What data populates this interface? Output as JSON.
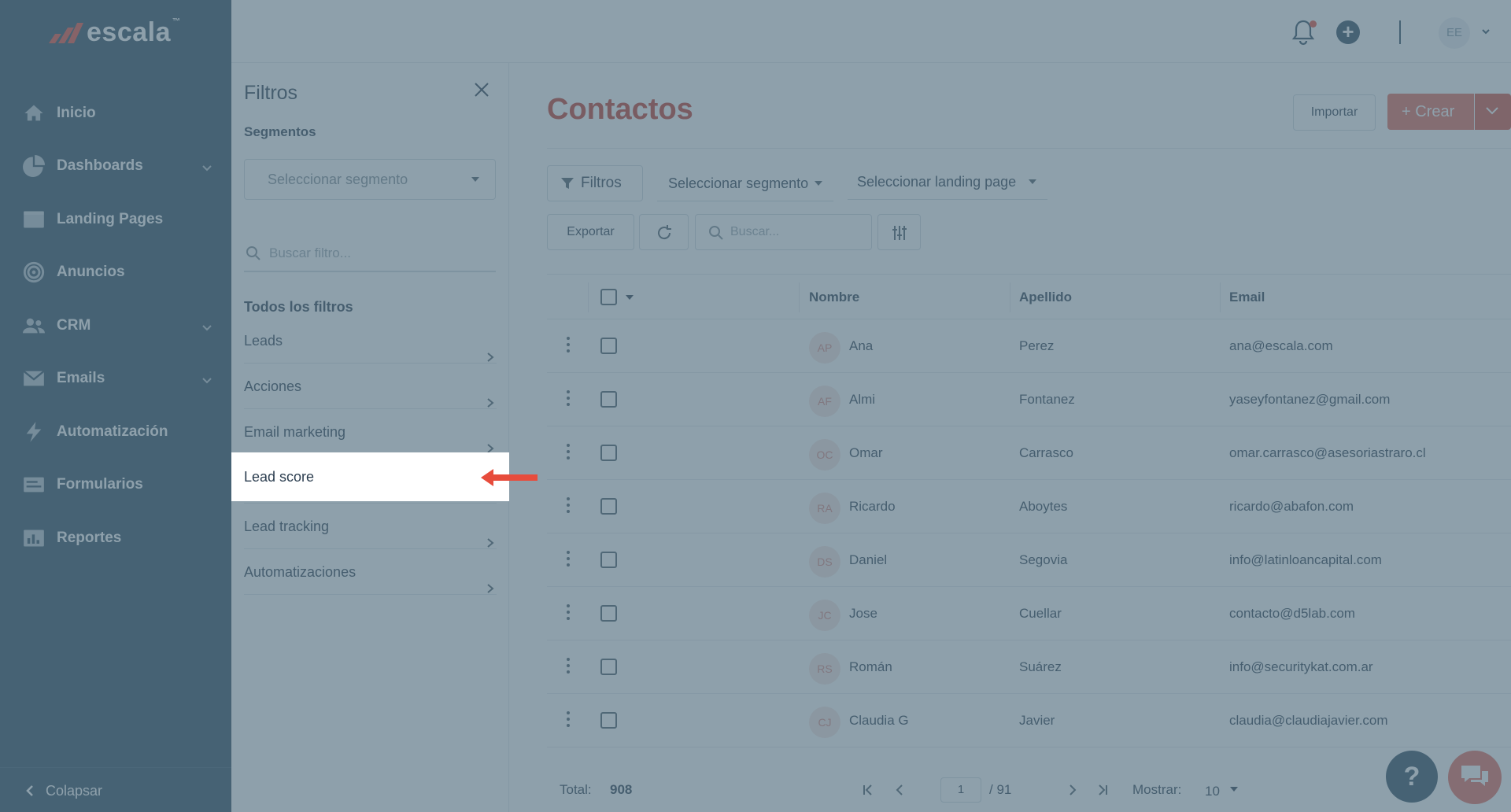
{
  "sidebar": {
    "logo": "escala",
    "logo_tm": "™",
    "items": [
      {
        "label": "Inicio",
        "icon": "home-icon",
        "chevron": false
      },
      {
        "label": "Dashboards",
        "icon": "pie-chart-icon",
        "chevron": true
      },
      {
        "label": "Landing Pages",
        "icon": "browser-icon",
        "chevron": false
      },
      {
        "label": "Anuncios",
        "icon": "target-icon",
        "chevron": false
      },
      {
        "label": "CRM",
        "icon": "users-icon",
        "chevron": true
      },
      {
        "label": "Emails",
        "icon": "mail-icon",
        "chevron": true
      },
      {
        "label": "Automatización",
        "icon": "lightning-icon",
        "chevron": false
      },
      {
        "label": "Formularios",
        "icon": "form-icon",
        "chevron": false
      },
      {
        "label": "Reportes",
        "icon": "bar-chart-icon",
        "chevron": false
      }
    ],
    "collapse_label": "Colapsar"
  },
  "topbar": {
    "avatar_initials": "EE"
  },
  "filters_panel": {
    "title": "Filtros",
    "segments_label": "Segmentos",
    "segment_placeholder": "Seleccionar segmento",
    "search_placeholder": "Buscar filtro...",
    "all_filters_label": "Todos los filtros",
    "items": [
      "Leads",
      "Acciones",
      "Email marketing",
      "Lead score",
      "Lead tracking",
      "Automatizaciones"
    ],
    "highlighted_item": "Lead score"
  },
  "main": {
    "title": "Contactos",
    "import_label": "Importar",
    "create_label": "Crear",
    "filters_button": "Filtros",
    "segment_select": "Seleccionar segmento",
    "landing_select": "Seleccionar landing page",
    "export_label": "Exportar",
    "search_placeholder": "Buscar..."
  },
  "table": {
    "columns": [
      "Nombre",
      "Apellido",
      "Email"
    ],
    "rows": [
      {
        "initials": "AP",
        "first": "Ana",
        "last": "Perez",
        "email": "ana@escala.com"
      },
      {
        "initials": "AF",
        "first": "Almi",
        "last": "Fontanez",
        "email": "yaseyfontanez@gmail.com"
      },
      {
        "initials": "OC",
        "first": "Omar",
        "last": "Carrasco",
        "email": "omar.carrasco@asesoriastraro.cl"
      },
      {
        "initials": "RA",
        "first": "Ricardo",
        "last": "Aboytes",
        "email": "ricardo@abafon.com"
      },
      {
        "initials": "DS",
        "first": "Daniel",
        "last": "Segovia",
        "email": "info@latinloancapital.com"
      },
      {
        "initials": "JC",
        "first": "Jose",
        "last": "Cuellar",
        "email": "contacto@d5lab.com"
      },
      {
        "initials": "RS",
        "first": "Román",
        "last": "Suárez",
        "email": "info@securitykat.com.ar"
      },
      {
        "initials": "CJ",
        "first": "Claudia G",
        "last": "Javier",
        "email": "claudia@claudiajavier.com"
      }
    ]
  },
  "footer": {
    "total_label": "Total:",
    "total_value": "908",
    "page_current": "1",
    "page_total": "/ 91",
    "show_label": "Mostrar:",
    "show_value": "10"
  },
  "help": {
    "label": "?"
  },
  "colors": {
    "sidebar_bg": "#2c4a5e",
    "accent_red": "#c0392b",
    "create_button": "#e06a5a",
    "overlay": "#546f80",
    "annotation_arrow": "#e74c3c"
  }
}
